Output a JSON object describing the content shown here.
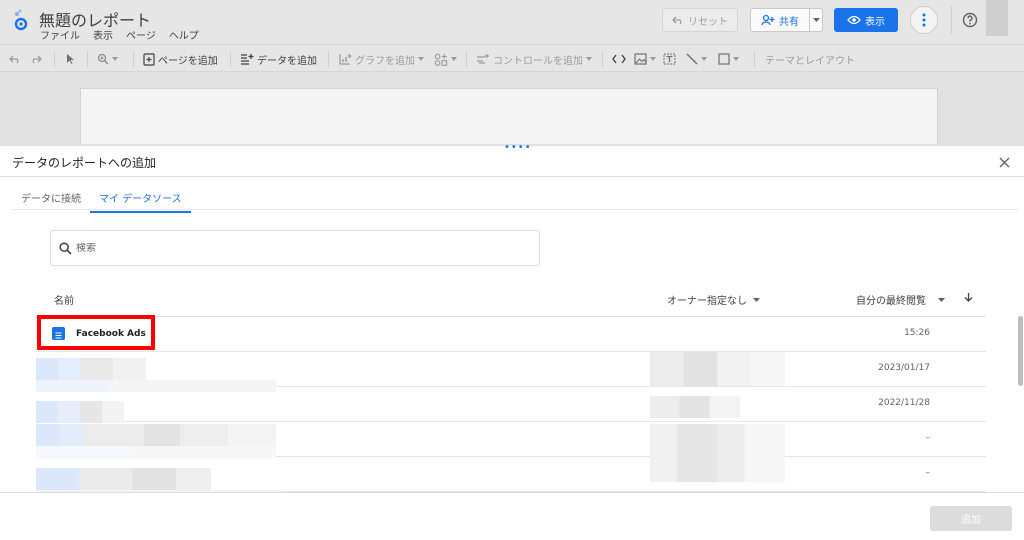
{
  "app": {
    "title": "無題のレポート",
    "menu": [
      "ファイル",
      "表示",
      "ページ",
      "ヘルプ"
    ]
  },
  "header_buttons": {
    "reset": "リセット",
    "share": "共有",
    "view": "表示"
  },
  "toolbar": {
    "add_page": "ページを追加",
    "add_data": "データを追加",
    "add_chart": "グラフを追加",
    "add_control": "コントロールを追加",
    "theme_layout": "テーマとレイアウト"
  },
  "panel": {
    "title": "データのレポートへの追加",
    "tabs": [
      {
        "label": "データに接続",
        "active": false
      },
      {
        "label": "マイ データソース",
        "active": true
      }
    ],
    "search_placeholder": "検索",
    "columns": {
      "name": "名前",
      "owner": "オーナー指定なし",
      "last_viewed": "自分の最終閲覧"
    },
    "rows": [
      {
        "name": "Facebook Ads",
        "date": "15:26"
      },
      {
        "name": "",
        "date": "2023/01/17"
      },
      {
        "name": "",
        "date": "2022/11/28"
      },
      {
        "name": "",
        "date": "–"
      },
      {
        "name": "",
        "date": "–"
      }
    ],
    "add_button": "追加"
  },
  "colors": {
    "accent": "#1a73e8",
    "highlight": "#ff0000",
    "chrome": "#e6e6e6"
  }
}
